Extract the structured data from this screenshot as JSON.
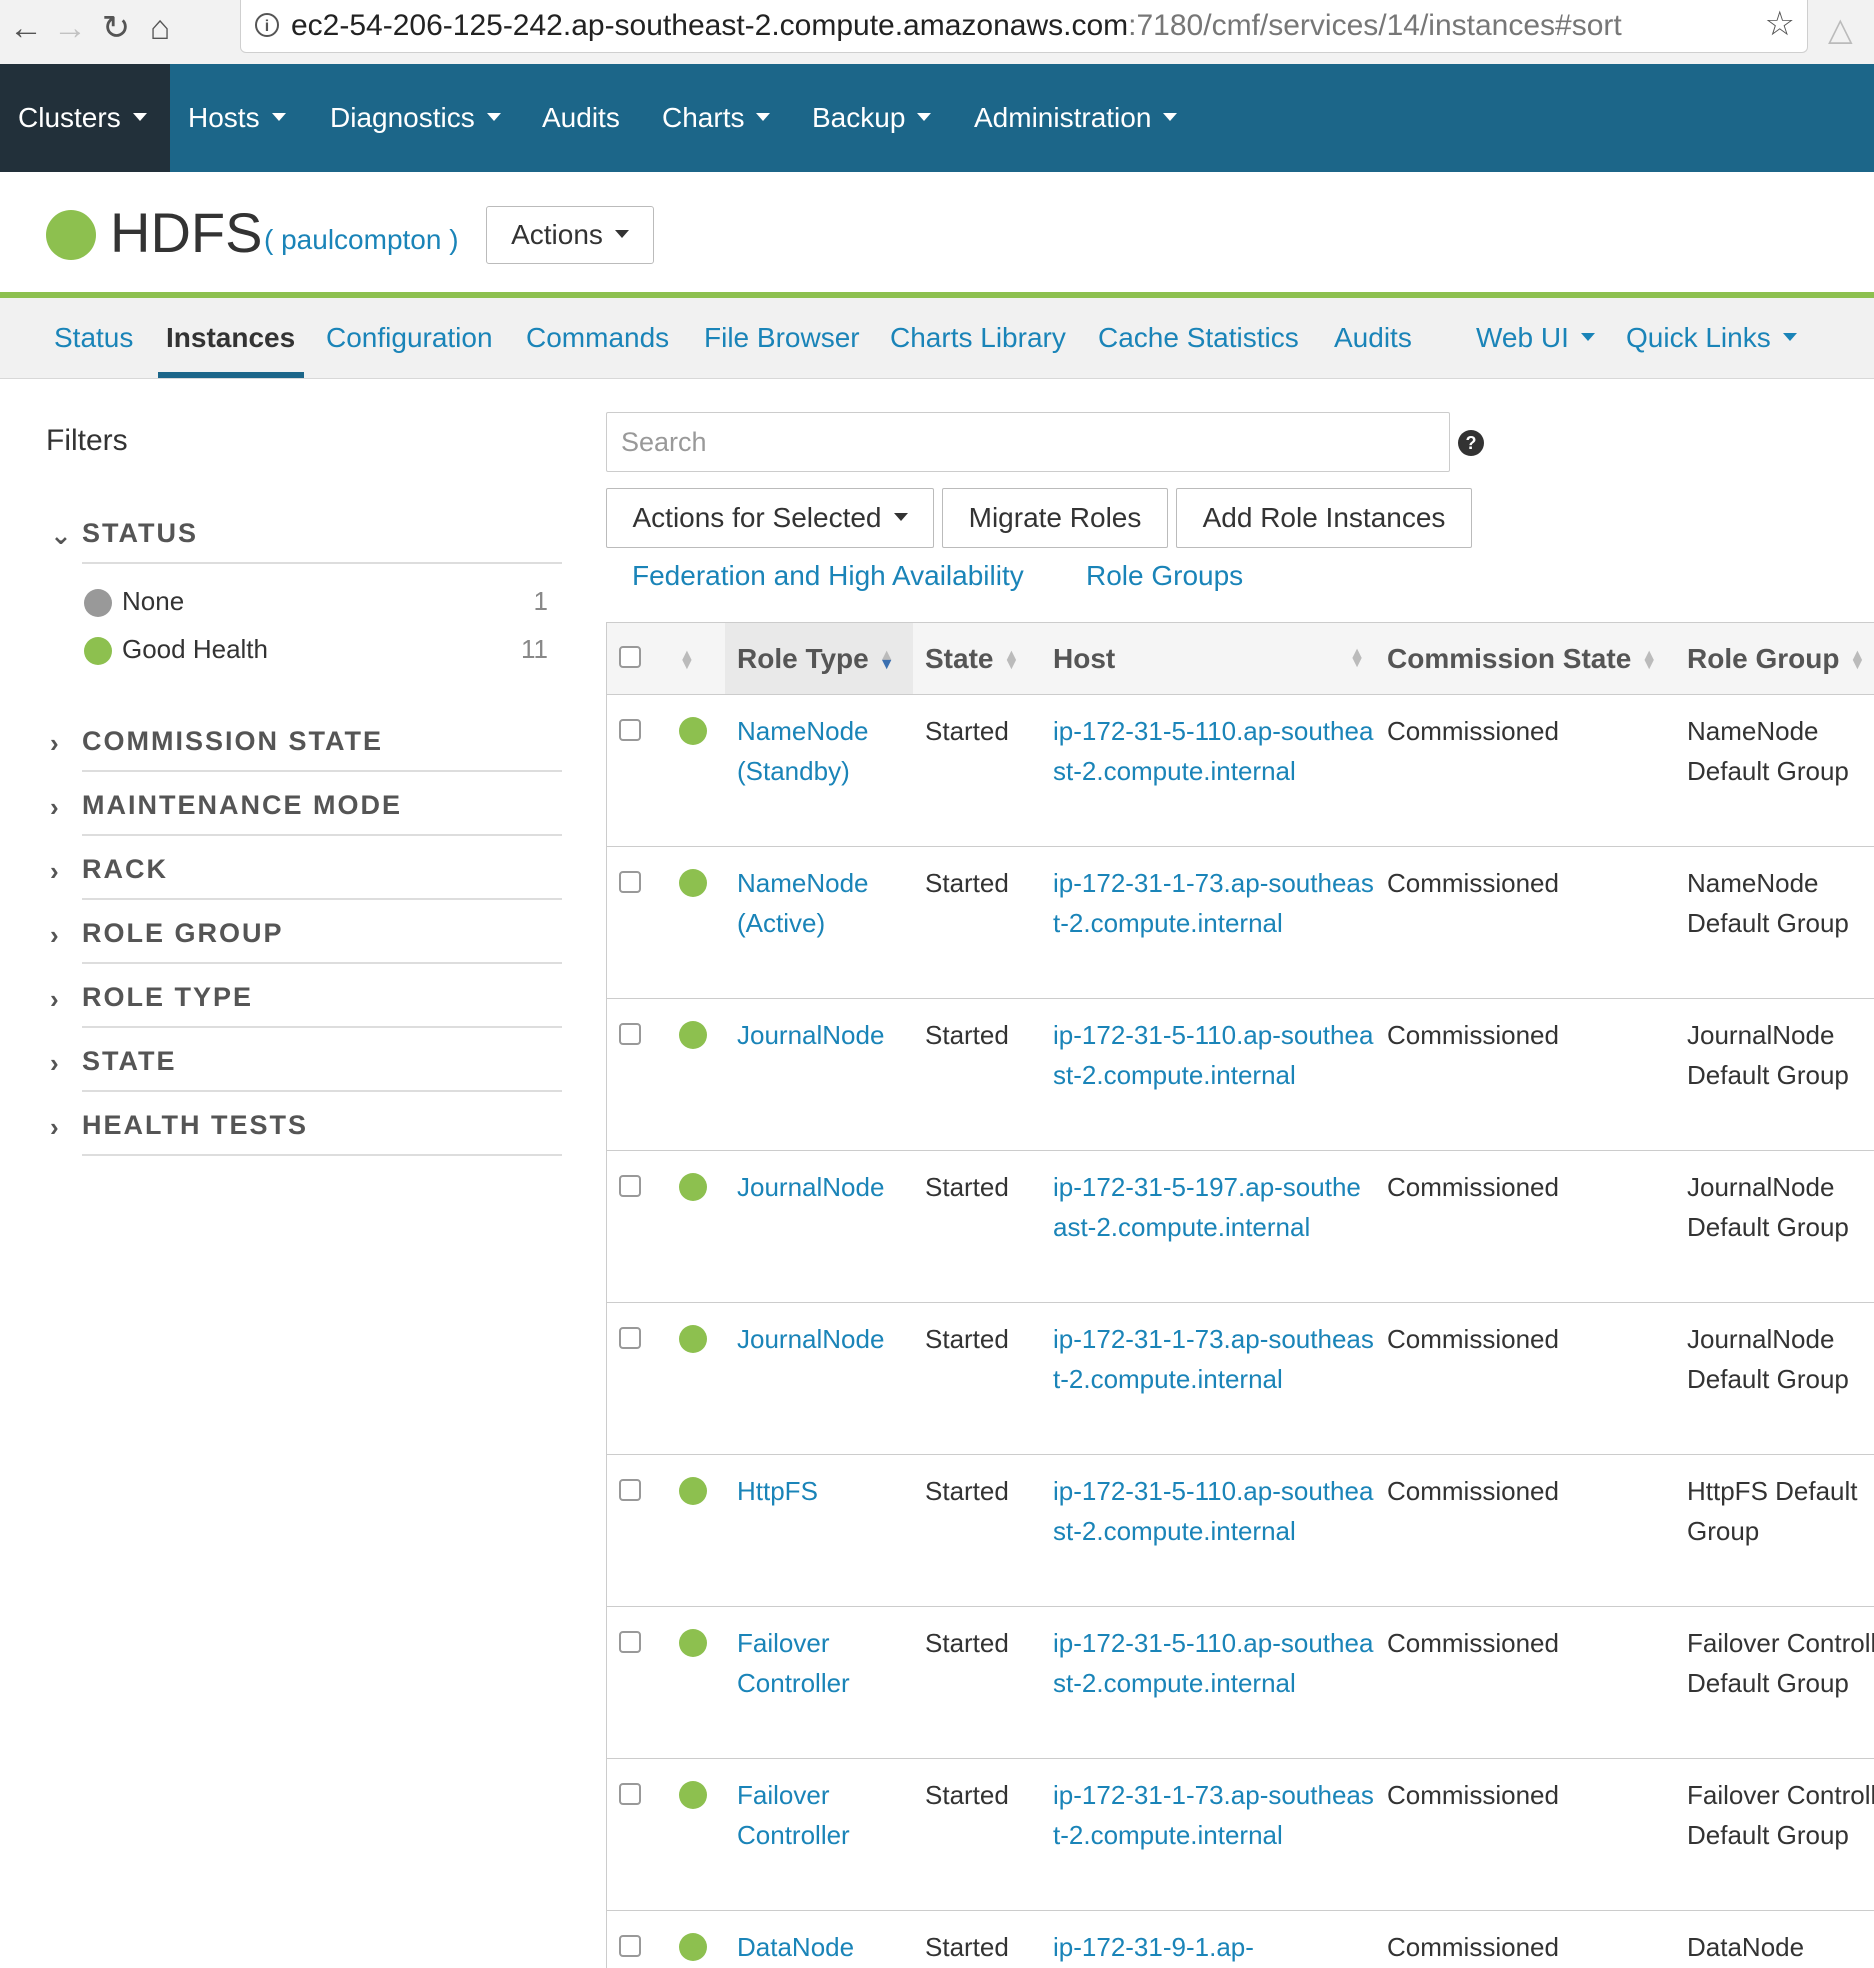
{
  "browser": {
    "url_host": "ec2-54-206-125-242.ap-southeast-2.compute.amazonaws.com",
    "url_path": ":7180/cmf/services/14/instances#sort"
  },
  "topnav": {
    "items": [
      {
        "label": "Clusters",
        "dropdown": true
      },
      {
        "label": "Hosts",
        "dropdown": true
      },
      {
        "label": "Diagnostics",
        "dropdown": true
      },
      {
        "label": "Audits",
        "dropdown": false
      },
      {
        "label": "Charts",
        "dropdown": true
      },
      {
        "label": "Backup",
        "dropdown": true
      },
      {
        "label": "Administration",
        "dropdown": true
      }
    ]
  },
  "service": {
    "name": "HDFS",
    "cluster": "( paulcompton )",
    "actions_label": "Actions",
    "health_color": "#8dc04f"
  },
  "subtabs": [
    {
      "label": "Status"
    },
    {
      "label": "Instances",
      "active": true
    },
    {
      "label": "Configuration"
    },
    {
      "label": "Commands"
    },
    {
      "label": "File Browser"
    },
    {
      "label": "Charts Library"
    },
    {
      "label": "Cache Statistics"
    },
    {
      "label": "Audits"
    },
    {
      "label": "Web UI",
      "dropdown": true
    },
    {
      "label": "Quick Links",
      "dropdown": true
    }
  ],
  "filters": {
    "title": "Filters",
    "status": {
      "label": "STATUS",
      "options": [
        {
          "name": "None",
          "count": "1",
          "color": "#999999"
        },
        {
          "name": "Good Health",
          "count": "11",
          "color": "#8dc04f"
        }
      ]
    },
    "collapsed": [
      "COMMISSION STATE",
      "MAINTENANCE MODE",
      "RACK",
      "ROLE GROUP",
      "ROLE TYPE",
      "STATE",
      "HEALTH TESTS"
    ]
  },
  "search": {
    "placeholder": "Search"
  },
  "buttons": {
    "actions_selected": "Actions for Selected",
    "migrate": "Migrate Roles",
    "add_role": "Add Role Instances"
  },
  "links": {
    "federation": "Federation and High Availability",
    "role_groups": "Role Groups"
  },
  "table": {
    "headers": {
      "role_type": "Role Type",
      "state": "State",
      "host": "Host",
      "commission_state": "Commission State",
      "role_group": "Role Group"
    },
    "rows": [
      {
        "role_type": "NameNode (Standby)",
        "state": "Started",
        "host": "ip-172-31-5-110.ap-southeast-2.compute.internal",
        "commission": "Commissioned",
        "role_group": "NameNode Default Group"
      },
      {
        "role_type": "NameNode (Active)",
        "state": "Started",
        "host": "ip-172-31-1-73.ap-southeast-2.compute.internal",
        "commission": "Commissioned",
        "role_group": "NameNode Default Group"
      },
      {
        "role_type": "JournalNode",
        "state": "Started",
        "host": "ip-172-31-5-110.ap-southeast-2.compute.internal",
        "commission": "Commissioned",
        "role_group": "JournalNode Default Group"
      },
      {
        "role_type": "JournalNode",
        "state": "Started",
        "host": "ip-172-31-5-197.ap-southeast-2.compute.internal",
        "commission": "Commissioned",
        "role_group": "JournalNode Default Group"
      },
      {
        "role_type": "JournalNode",
        "state": "Started",
        "host": "ip-172-31-1-73.ap-southeast-2.compute.internal",
        "commission": "Commissioned",
        "role_group": "JournalNode Default Group"
      },
      {
        "role_type": "HttpFS",
        "state": "Started",
        "host": "ip-172-31-5-110.ap-southeast-2.compute.internal",
        "commission": "Commissioned",
        "role_group": "HttpFS Default Group"
      },
      {
        "role_type": "Failover Controller",
        "state": "Started",
        "host": "ip-172-31-5-110.ap-southeast-2.compute.internal",
        "commission": "Commissioned",
        "role_group": "Failover Controller Default Group"
      },
      {
        "role_type": "Failover Controller",
        "state": "Started",
        "host": "ip-172-31-1-73.ap-southeast-2.compute.internal",
        "commission": "Commissioned",
        "role_group": "Failover Controller Default Group"
      },
      {
        "role_type": "DataNode",
        "state": "Started",
        "host": "ip-172-31-9-1.ap-",
        "commission": "Commissioned",
        "role_group": "DataNode"
      }
    ]
  }
}
